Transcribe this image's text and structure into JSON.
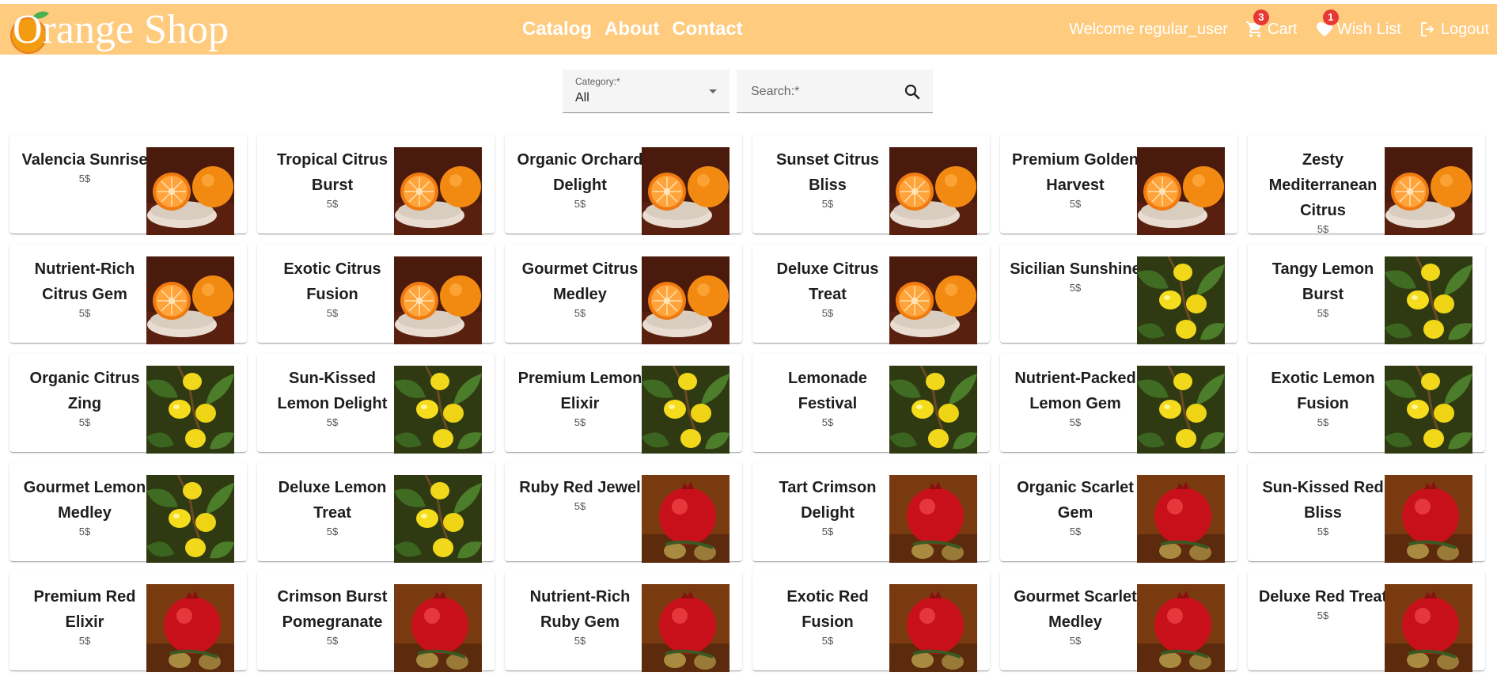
{
  "header": {
    "logo_text": "Orange Shop",
    "nav": [
      "Catalog",
      "About",
      "Contact"
    ],
    "welcome": "Welcome regular_user",
    "cart_label": "Cart",
    "cart_count": "3",
    "wishlist_label": "Wish List",
    "wishlist_count": "1",
    "logout_label": "Logout",
    "icons": [
      "cart-icon",
      "heart-icon",
      "logout-icon"
    ],
    "bar_color": "#fecb7f"
  },
  "filters": {
    "category_label": "Category:*",
    "category_value": "All",
    "search_placeholder": "Search:*",
    "search_icon": "search-icon"
  },
  "products": [
    {
      "name": "Valencia Sunrise",
      "price": "5$",
      "image": "orange"
    },
    {
      "name": "Tropical Citrus Burst",
      "price": "5$",
      "image": "orange"
    },
    {
      "name": "Organic Orchard Delight",
      "price": "5$",
      "image": "orange"
    },
    {
      "name": "Sunset Citrus Bliss",
      "price": "5$",
      "image": "orange"
    },
    {
      "name": "Premium Golden Harvest",
      "price": "5$",
      "image": "orange"
    },
    {
      "name": "Zesty Mediterranean Citrus",
      "price": "5$",
      "image": "orange"
    },
    {
      "name": "Nutrient-Rich Citrus Gem",
      "price": "5$",
      "image": "orange"
    },
    {
      "name": "Exotic Citrus Fusion",
      "price": "5$",
      "image": "orange"
    },
    {
      "name": "Gourmet Citrus Medley",
      "price": "5$",
      "image": "orange"
    },
    {
      "name": "Deluxe Citrus Treat",
      "price": "5$",
      "image": "orange"
    },
    {
      "name": "Sicilian Sunshine",
      "price": "5$",
      "image": "lemon"
    },
    {
      "name": "Tangy Lemon Burst",
      "price": "5$",
      "image": "lemon"
    },
    {
      "name": "Organic Citrus Zing",
      "price": "5$",
      "image": "lemon"
    },
    {
      "name": "Sun-Kissed Lemon Delight",
      "price": "5$",
      "image": "lemon"
    },
    {
      "name": "Premium Lemon Elixir",
      "price": "5$",
      "image": "lemon"
    },
    {
      "name": "Lemonade Festival",
      "price": "5$",
      "image": "lemon"
    },
    {
      "name": "Nutrient-Packed Lemon Gem",
      "price": "5$",
      "image": "lemon"
    },
    {
      "name": "Exotic Lemon Fusion",
      "price": "5$",
      "image": "lemon"
    },
    {
      "name": "Gourmet Lemon Medley",
      "price": "5$",
      "image": "lemon"
    },
    {
      "name": "Deluxe Lemon Treat",
      "price": "5$",
      "image": "lemon"
    },
    {
      "name": "Ruby Red Jewel",
      "price": "5$",
      "image": "pomegranate"
    },
    {
      "name": "Tart Crimson Delight",
      "price": "5$",
      "image": "pomegranate"
    },
    {
      "name": "Organic Scarlet Gem",
      "price": "5$",
      "image": "pomegranate"
    },
    {
      "name": "Sun-Kissed Red Bliss",
      "price": "5$",
      "image": "pomegranate"
    },
    {
      "name": "Premium Red Elixir",
      "price": "5$",
      "image": "pomegranate"
    },
    {
      "name": "Crimson Burst Pomegranate",
      "price": "5$",
      "image": "pomegranate"
    },
    {
      "name": "Nutrient-Rich Ruby Gem",
      "price": "5$",
      "image": "pomegranate"
    },
    {
      "name": "Exotic Red Fusion",
      "price": "5$",
      "image": "pomegranate"
    },
    {
      "name": "Gourmet Scarlet Medley",
      "price": "5$",
      "image": "pomegranate"
    },
    {
      "name": "Deluxe Red Treat",
      "price": "5$",
      "image": "pomegranate"
    }
  ]
}
